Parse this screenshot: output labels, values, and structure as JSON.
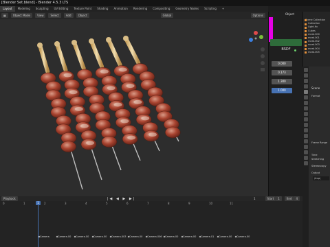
{
  "window": {
    "title": "[Blender Set.blend] - Blender 4.5.3 LTS"
  },
  "workspace_tabs": [
    "Layout",
    "Modeling",
    "Sculpting",
    "UV Editing",
    "Texture Paint",
    "Shading",
    "Animation",
    "Rendering",
    "Compositing",
    "Geometry Nodes",
    "Scripting",
    "+"
  ],
  "active_tab": "Layout",
  "viewport_header": {
    "mode": "Object Mode",
    "view": "View",
    "select": "Select",
    "add": "Add",
    "object": "Object",
    "transform": "Global",
    "options": "Options"
  },
  "node_panel": {
    "header": "Object",
    "bsdf_label": "BSDF",
    "values": [
      "0.000",
      "0.173",
      "1.300",
      "1.000"
    ],
    "selected_index": 3
  },
  "outliner": {
    "items": [
      "Scene Collection",
      "Collection",
      "Light.fix",
      "Cubes",
      "meat.000",
      "meat.001",
      "meat.002",
      "meat.003",
      "meat.004",
      "meat.005"
    ]
  },
  "properties": {
    "scene_label": "Scene",
    "sections": [
      "Format",
      "Frame Range",
      "Time Stretching",
      "Stereoscopy",
      "Output"
    ],
    "output_path": "/tmp\\"
  },
  "timeline": {
    "playback": "Playback",
    "start_label": "Start",
    "start": "1",
    "end_label": "End",
    "end": "4",
    "current_frame": "1",
    "frame_numbers": [
      "0",
      "1",
      "2",
      "3",
      "4",
      "5",
      "6",
      "7",
      "8",
      "9",
      "10",
      "11"
    ],
    "markers": [
      "Camera",
      "Camera.00",
      "Camera.00",
      "Camera.00",
      "Camera.003",
      "Camera.00",
      "Camera.006",
      "Camera.00",
      "Camera.00",
      "Camera.01",
      "Camera.00",
      "Camera.00"
    ]
  },
  "colors": {
    "accent": "#4772b3",
    "node_green": "#2e6b3a",
    "pink": "#e600e6",
    "meat": "#9a3b2a",
    "handle": "#d2b27a"
  }
}
